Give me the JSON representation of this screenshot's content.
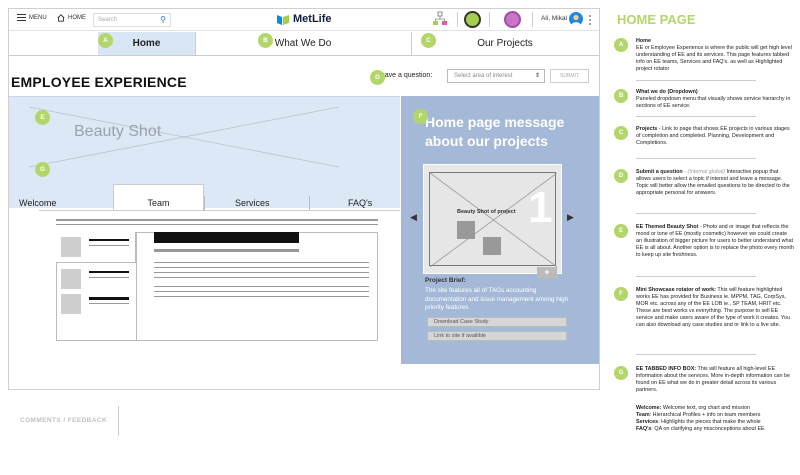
{
  "topbar": {
    "menu_label": "MENU",
    "home_label": "HOME",
    "search_placeholder": "Search",
    "brand": "MetLife",
    "user_name": "Ali, Mikal"
  },
  "tabs": [
    {
      "label": "Home",
      "badge": "A"
    },
    {
      "label": "What We Do",
      "badge": "B"
    },
    {
      "label": "Our Projects",
      "badge": "C"
    }
  ],
  "page": {
    "title": "EMPLOYEE EXPERIENCE",
    "question_label": "I have a question:",
    "question_badge": "D",
    "question_placeholder": "Select area of interest",
    "submit_label": "SUBMIT",
    "beauty_label": "Beauty Shot",
    "beauty_badge": "E",
    "tabbed_badge": "G"
  },
  "info_tabs": [
    "Welcome",
    "Team",
    "Services",
    "FAQ's"
  ],
  "showcase": {
    "badge": "F",
    "title": "Home page message about our projects",
    "image_label": "Beauty Shot of project",
    "number": "1",
    "brief_heading": "Project Brief:",
    "brief_text": "The site features all of TAGs accounting documentation and issue management among high priority features.",
    "download_label": "Download Case Study",
    "link_label": "Link to site if availible"
  },
  "footer": {
    "comments_label": "COMMENTS / FEEDBACK"
  },
  "annotations": {
    "heading": "HOME PAGE",
    "notes": [
      {
        "badge": "A",
        "title": "Home",
        "body": "EE or Employee Experience is where the public will get high level understanding of EE and its services. This page features tabbed info on EE teams, Services and FAQ's. as well as Highlighted project rotator"
      },
      {
        "badge": "B",
        "title": "What we do (Dropdown)",
        "body": "Paneled dropdown menu that visually shows service hierarchy in sections of EE service."
      },
      {
        "badge": "C",
        "title": "Projects",
        "body": "- Link to page that shows EE projects in various stages of completion and completed. Planning, Development and Completions."
      },
      {
        "badge": "D",
        "title": "Submit a question",
        "aside": "- (Internal global)",
        "body": "Interactive popup that allows users to select a topic if interest and leave a message. Topic will better allow the emailed questions to be directed to the appropriate personal for answers."
      },
      {
        "badge": "E",
        "title": "EE Themed Beauty Shot",
        "body": "- Photo and or image that reflects the mood or tone of EE (mostly cosmetic) however we could create an illustration of bigger picture for users to better understand what EE is all about. Another option is to replace the photo every month to keep up site freshness."
      },
      {
        "badge": "F",
        "title": "Mini Showcase rotator of work:",
        "body": "This will feature highlighted works EE has provided for Business ie. MPPM, TAG, CorpSys, MOR etc. across any of the EE LOB ie., SP TEAM, HRIT etc. These are best works vs everything. The purpose to sell EE service and make users aware of the type of work it creates. You can also download any case studies and or link to a live site."
      },
      {
        "badge": "G",
        "title": "EE TABBED INFO BOX:",
        "body": "This will feature all high-level EE information about the services. More in-depth information can be found on EE what we do in greater detail across its various partners."
      }
    ],
    "tab_notes": [
      {
        "term": "Welcome:",
        "text": "Welcome text, org chart and mission"
      },
      {
        "term": "Team",
        "text": ": Hierarchical Profiles + info on team members"
      },
      {
        "term": "Services",
        "text": ": Highlights the pieces that make the whole"
      },
      {
        "term": "FAQ's",
        "text": ": QA on clarifying any misconceptions about EE"
      }
    ]
  },
  "colors": {
    "accent_green": "#b3d66a",
    "showcase_blue": "#a4b8d8",
    "beauty_blue": "#dde8f6",
    "brand_navy": "#0f1e3c",
    "active_tab": "#d9e6f5"
  }
}
